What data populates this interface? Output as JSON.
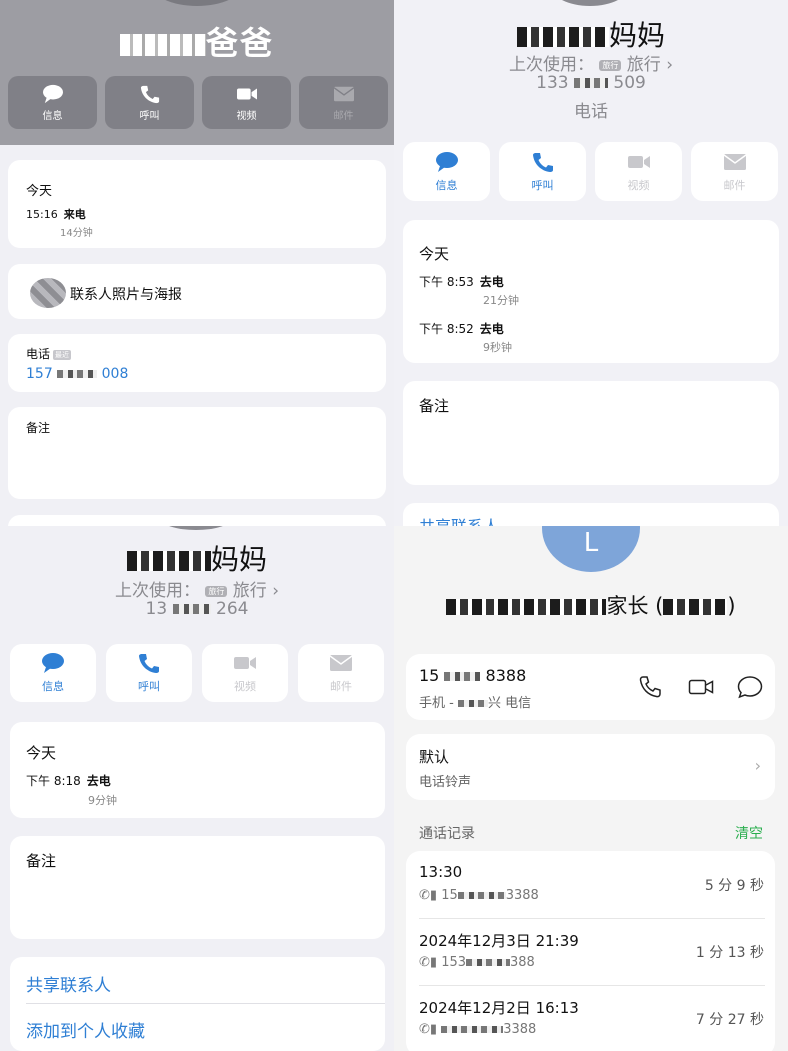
{
  "p1": {
    "name": "爸爸",
    "actions": [
      "信息",
      "呼叫",
      "视频",
      "邮件"
    ],
    "recent_title": "今天",
    "recent_time": "15:16",
    "recent_type": "来电",
    "recent_duration": "14分钟",
    "photo_label": "联系人照片与海报",
    "phone_label": "电话",
    "phone_tag": "最近",
    "phone_prefix": "157",
    "phone_suffix": "008",
    "notes_label": "备注"
  },
  "p2": {
    "name": "妈妈",
    "last_used_label": "上次使用：",
    "last_used_tag": "旅行",
    "last_used_value": "旅行",
    "number_prefix": "133",
    "number_suffix": "509",
    "number_type": "电话",
    "actions": [
      "信息",
      "呼叫",
      "视频",
      "邮件"
    ],
    "recent_title": "今天",
    "calls": [
      {
        "time": "下午 8:53",
        "type": "去电",
        "duration": "21分钟"
      },
      {
        "time": "下午 8:52",
        "type": "去电",
        "duration": "9秒钟"
      }
    ],
    "notes_label": "备注",
    "share_label": "共享联系人"
  },
  "p3": {
    "name": "妈妈",
    "last_used_label": "上次使用：",
    "last_used_tag": "旅行",
    "last_used_value": "旅行",
    "number_prefix": "13",
    "number_suffix": "264",
    "actions": [
      "信息",
      "呼叫",
      "视频",
      "邮件"
    ],
    "recent_title": "今天",
    "call": {
      "time": "下午 8:18",
      "type": "去电",
      "duration": "9分钟"
    },
    "notes_label": "备注",
    "share_label": "共享联系人",
    "favorite_label": "添加到个人收藏"
  },
  "p4": {
    "avatar_letter": "L",
    "name": "家长 (",
    "name_end": ")",
    "phone_prefix": "15",
    "phone_suffix": "8388",
    "phone_sub_prefix": "手机 - ",
    "phone_sub_suffix": "兴 电信",
    "ringtone_title": "默认",
    "ringtone_sub": "电话铃声",
    "log_title": "通话记录",
    "log_clear": "清空",
    "log": [
      {
        "when": "13:30",
        "via_prefix": "15",
        "via_suffix": "3388",
        "len": "5 分 9 秒"
      },
      {
        "when": "2024年12月3日 21:39",
        "via_prefix": "153",
        "via_suffix": "388",
        "len": "1 分 13 秒"
      },
      {
        "when": "2024年12月2日 16:13",
        "via_prefix": "",
        "via_suffix": "3388",
        "len": "7 分 27 秒"
      }
    ],
    "colors": {
      "accent": "#2f7fd4",
      "clear": "#2aae4e"
    }
  }
}
